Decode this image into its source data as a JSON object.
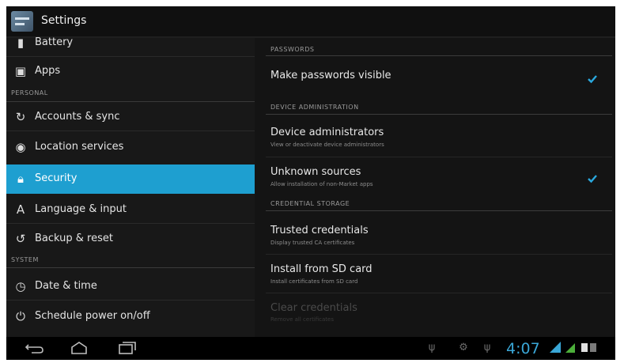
{
  "actionbar": {
    "title": "Settings",
    "icon": "settings-app-icon"
  },
  "sidebar": {
    "items": [
      {
        "label": "Battery",
        "icon": "battery-icon"
      },
      {
        "label": "Apps",
        "icon": "apps-icon"
      },
      {
        "label": "Accounts & sync",
        "icon": "sync-icon"
      },
      {
        "label": "Location services",
        "icon": "location-icon"
      },
      {
        "label": "Security",
        "icon": "lock-icon",
        "selected": true
      },
      {
        "label": "Language & input",
        "icon": "language-icon"
      },
      {
        "label": "Backup & reset",
        "icon": "backup-icon"
      },
      {
        "label": "Date & time",
        "icon": "clock-icon"
      },
      {
        "label": "Schedule power on/off",
        "icon": "power-icon"
      }
    ],
    "headers": {
      "personal": "PERSONAL",
      "system": "SYSTEM"
    }
  },
  "security": {
    "sections": {
      "passwords": "PASSWORDS",
      "device_admin": "DEVICE ADMINISTRATION",
      "credential_storage": "CREDENTIAL STORAGE"
    },
    "make_passwords_visible": {
      "title": "Make passwords visible",
      "checked": true
    },
    "device_administrators": {
      "title": "Device administrators",
      "subtitle": "View or deactivate device administrators"
    },
    "unknown_sources": {
      "title": "Unknown sources",
      "subtitle": "Allow installation of non-Market apps",
      "checked": true
    },
    "trusted_credentials": {
      "title": "Trusted credentials",
      "subtitle": "Display trusted CA certificates"
    },
    "install_from_sd": {
      "title": "Install from SD card",
      "subtitle": "Install certificates from SD card"
    },
    "clear_credentials": {
      "title": "Clear credentials",
      "subtitle": "Remove all certificates",
      "disabled": true
    }
  },
  "statusbar": {
    "time": "4:07"
  },
  "colors": {
    "accent": "#1e9fd0",
    "clock": "#3aa7d7"
  }
}
